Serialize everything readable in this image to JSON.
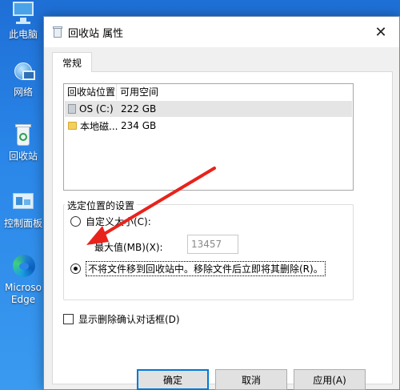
{
  "desktop": {
    "icons": [
      {
        "label": "此电脑",
        "icon": "this-pc-icon"
      },
      {
        "label": "网络",
        "icon": "network-icon"
      },
      {
        "label": "回收站",
        "icon": "recycle-bin-icon"
      },
      {
        "label": "控制面板",
        "icon": "control-panel-icon"
      },
      {
        "label": "Microsoft Edge",
        "label_line1": "Microso",
        "label_line2": "Edge",
        "icon": "edge-icon"
      }
    ]
  },
  "window": {
    "title": "回收站 属性",
    "close_glyph": "✕",
    "tabs": [
      {
        "label": "常规",
        "active": true
      }
    ],
    "location_list": {
      "columns": [
        "回收站位置",
        "可用空间"
      ],
      "rows": [
        {
          "name": "OS (C:)",
          "space": "222 GB",
          "icon": "drive-icon",
          "selected": true
        },
        {
          "name": "本地磁...",
          "space": "234 GB",
          "icon": "folder-icon",
          "selected": false
        }
      ]
    },
    "settings_group": {
      "label": "选定位置的设置",
      "custom_size_label": "自定义大小(C):",
      "max_size_label": "最大值(MB)(X):",
      "max_size_value": "13457",
      "no_recycle_label": "不将文件移到回收站中。移除文件后立即将其删除(R)。",
      "selected_option": "no_recycle"
    },
    "confirm_checkbox": {
      "label": "显示删除确认对话框(D)",
      "checked": false
    },
    "buttons": {
      "ok": "确定",
      "cancel": "取消",
      "apply": "应用(A)"
    }
  },
  "colors": {
    "desktop_bg": "#2a86e8",
    "annotation_arrow": "#e8231c",
    "default_button_border": "#0078d7"
  }
}
